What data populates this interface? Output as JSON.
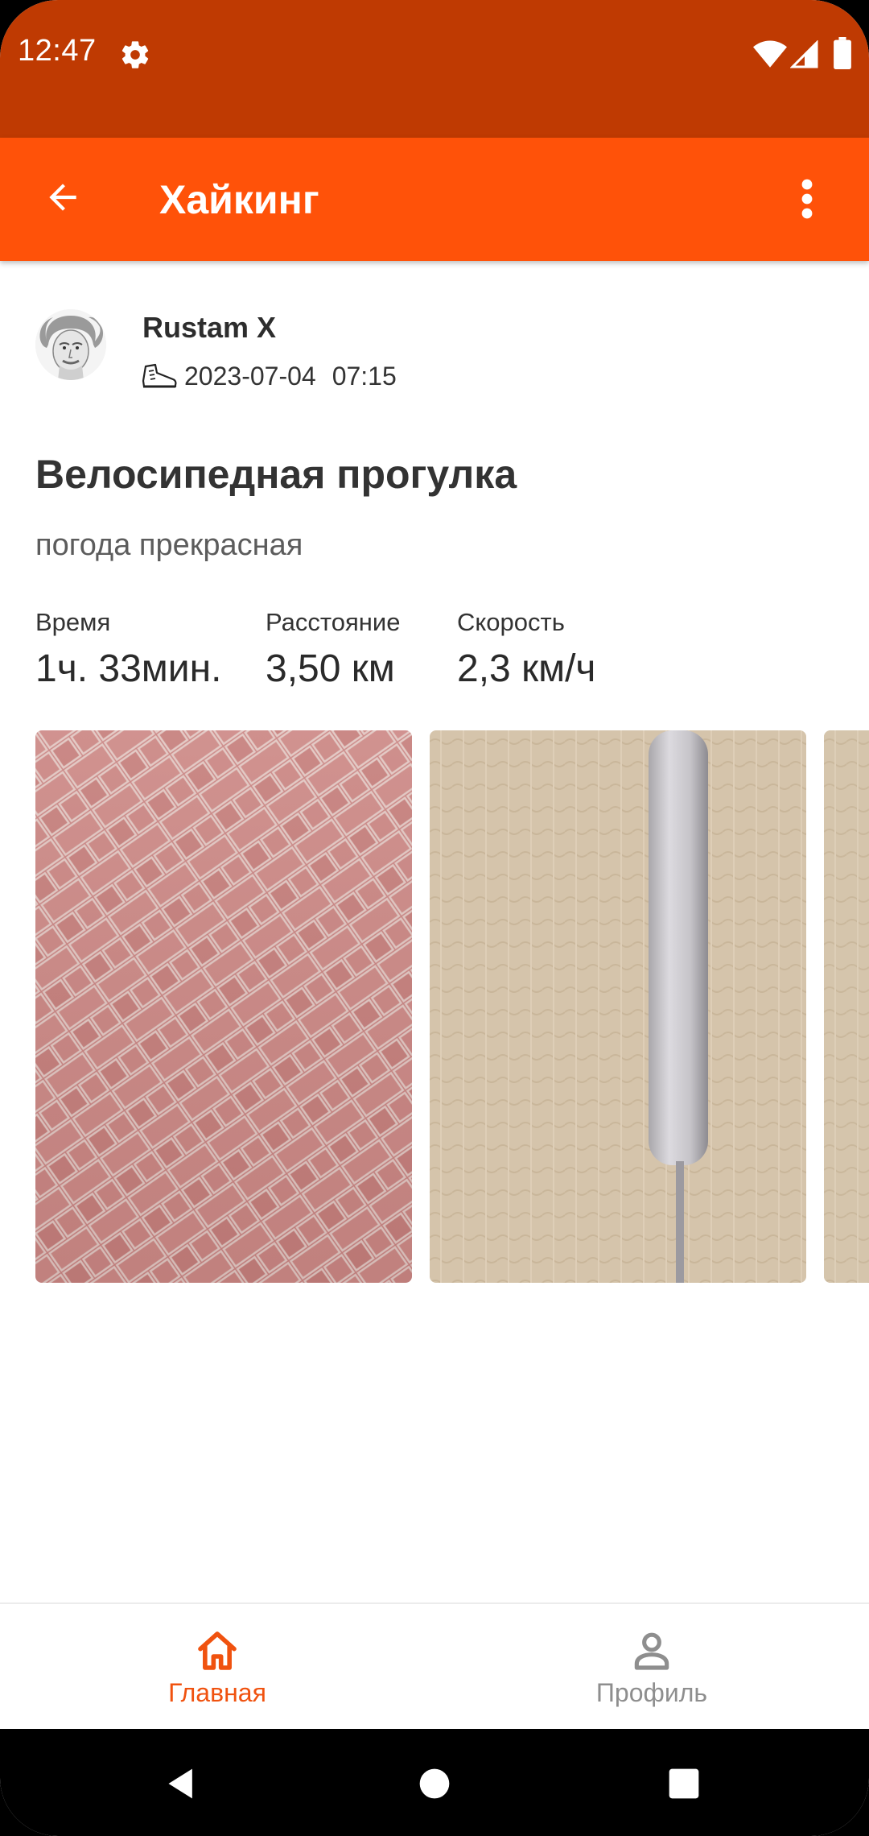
{
  "status_bar": {
    "time": "12:47",
    "icons": [
      "gear-icon",
      "wifi-icon",
      "signal-icon",
      "battery-icon"
    ]
  },
  "app_bar": {
    "title": "Хайкинг",
    "icons": [
      "arrow-back-icon",
      "more-vert-icon"
    ]
  },
  "author": {
    "name": "Rustam X",
    "date": "2023-07-04",
    "time": "07:15",
    "activity_icon": "hiking-boot-icon"
  },
  "post": {
    "title": "Велосипедная прогулка",
    "description": "погода прекрасная"
  },
  "stats": [
    {
      "label": "Время",
      "value": "1ч. 33мин."
    },
    {
      "label": "Расстояние",
      "value": "3,50 км"
    },
    {
      "label": "Скорость",
      "value": "2,3 км/ч"
    }
  ],
  "photos": [
    "paving-bricks-photo",
    "wall-pipe-photo",
    "wall-photo"
  ],
  "bottom_nav": {
    "items": [
      {
        "label": "Главная",
        "icon": "home-icon",
        "active": true
      },
      {
        "label": "Профиль",
        "icon": "person-icon",
        "active": false
      }
    ]
  },
  "colors": {
    "status_bar": "#BF3A02",
    "app_bar": "#FF5209",
    "accent": "#F0520F",
    "inactive": "#8e8e8e"
  }
}
